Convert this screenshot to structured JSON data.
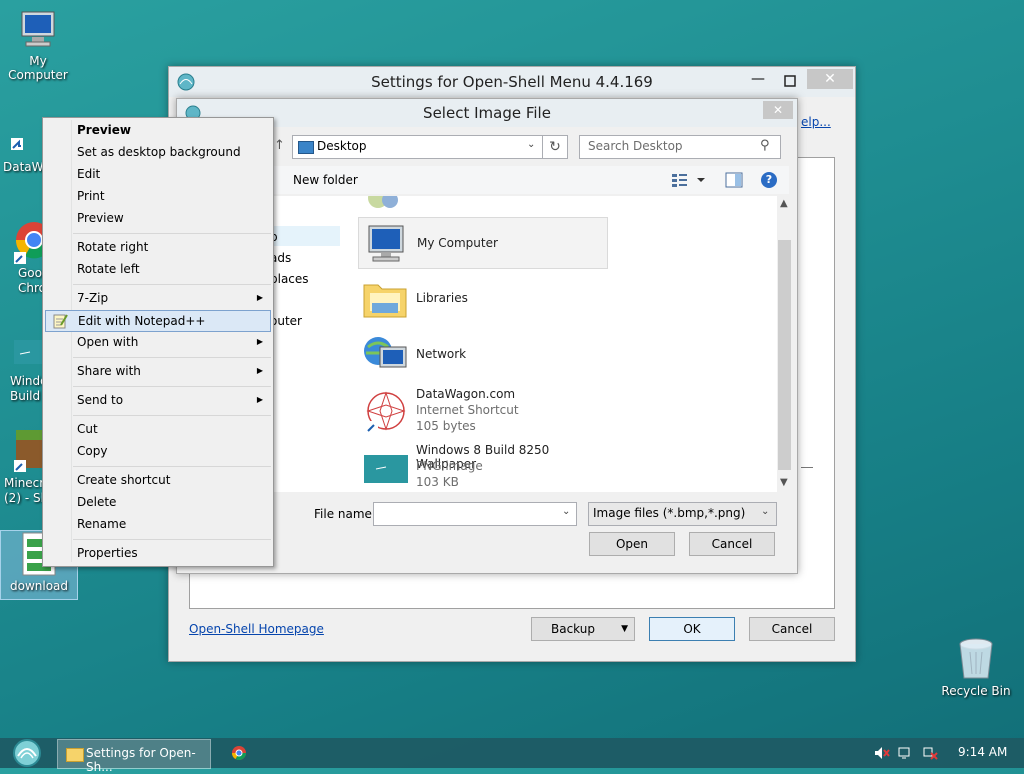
{
  "desktop": {
    "icons": [
      {
        "label": "My Computer"
      },
      {
        "label": "DataWa"
      },
      {
        "label": "Goo\nChro"
      },
      {
        "label": "Windo\nBuild 8"
      },
      {
        "label": "Minecr\n(2) - Sh"
      },
      {
        "label": "download"
      },
      {
        "label": "Recycle Bin"
      }
    ]
  },
  "settings_window": {
    "title": "Settings for Open-Shell Menu 4.4.169",
    "help_link": "elp...",
    "homepage_link": "Open-Shell Homepage",
    "backup_label": "Backup",
    "ok_label": "OK",
    "cancel_label": "Cancel"
  },
  "dialog": {
    "title": "Select Image File",
    "location": "Desktop",
    "search_placeholder": "Search Desktop",
    "new_folder": "New folder",
    "nav_fragments": [
      "p",
      "ads",
      "places",
      "outer"
    ],
    "items": [
      {
        "name": "My Computer",
        "type": "",
        "size": ""
      },
      {
        "name": "Libraries",
        "type": "",
        "size": ""
      },
      {
        "name": "Network",
        "type": "",
        "size": ""
      },
      {
        "name": "DataWagon.com",
        "type": "Internet Shortcut",
        "size": "105 bytes"
      },
      {
        "name": "Windows 8 Build 8250 Wallpaper",
        "type": "PNG image",
        "size": "103 KB"
      }
    ],
    "file_name_label": "File name:",
    "file_name_value": "",
    "filter": "Image files (*.bmp,*.png)",
    "open_label": "Open",
    "cancel_label": "Cancel"
  },
  "context_menu": {
    "items": [
      {
        "label": "Preview",
        "bold": true
      },
      {
        "label": "Set as desktop background"
      },
      {
        "label": "Edit"
      },
      {
        "label": "Print"
      },
      {
        "label": "Preview"
      },
      {
        "label": "Rotate right"
      },
      {
        "label": "Rotate left"
      },
      {
        "label": "7-Zip"
      },
      {
        "label": "Edit with Notepad++"
      },
      {
        "label": "Open with"
      },
      {
        "label": "Share with"
      },
      {
        "label": "Send to"
      },
      {
        "label": "Cut"
      },
      {
        "label": "Copy"
      },
      {
        "label": "Create shortcut"
      },
      {
        "label": "Delete"
      },
      {
        "label": "Rename"
      },
      {
        "label": "Properties"
      }
    ]
  },
  "taskbar": {
    "task_label": "Settings for Open-Sh...",
    "clock": "9:14 AM"
  },
  "colors": {
    "desktop": "#1f8e92",
    "menu_highlight": "#dbe8f6",
    "taskbar": "#1e5a64"
  }
}
